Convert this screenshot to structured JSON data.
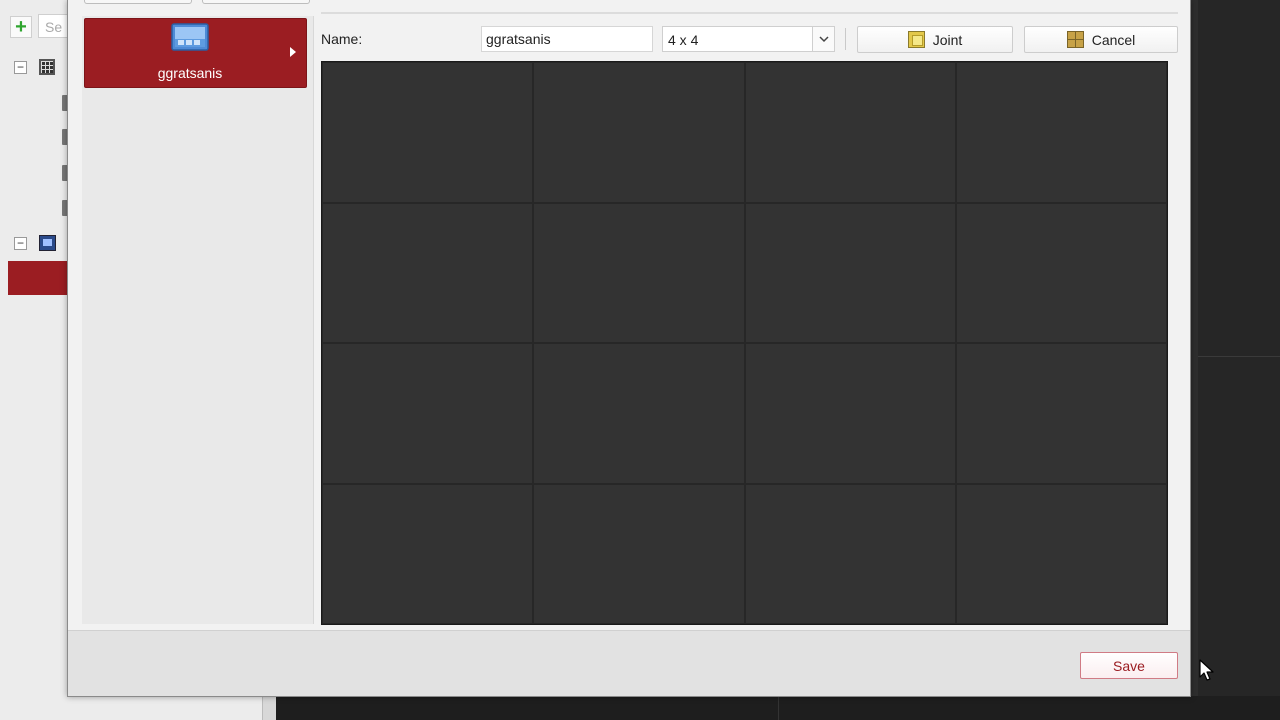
{
  "background": {
    "search_placeholder": "Se"
  },
  "layout_list": {
    "items": [
      {
        "label": "ggratsanis",
        "selected": true,
        "icon": "monitor-layout-icon"
      }
    ]
  },
  "editor": {
    "name_label": "Name:",
    "name_value": "ggratsanis",
    "grid_select": {
      "value": "4 x 4"
    },
    "joint_label": "Joint",
    "cancel_label": "Cancel",
    "grid": {
      "rows": 4,
      "cols": 4
    }
  },
  "footer": {
    "save_label": "Save"
  },
  "colors": {
    "accent_red": "#9b1d22",
    "preview_bg": "#333333",
    "save_text": "#9b1d22"
  }
}
